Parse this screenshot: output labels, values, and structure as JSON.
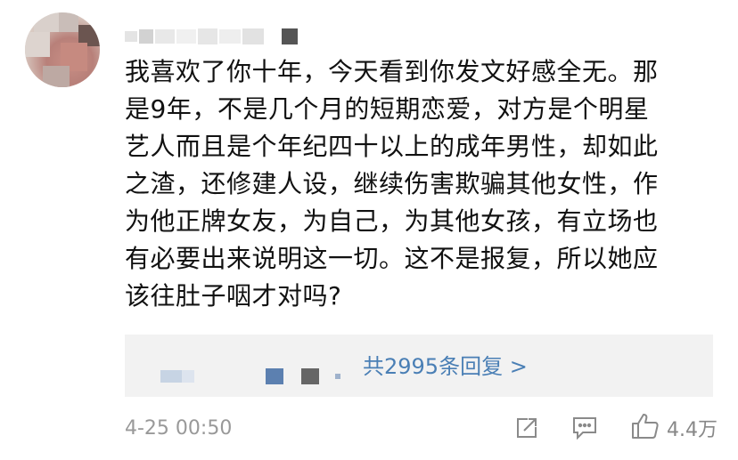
{
  "comment": {
    "text": "我喜欢了你十年，今天看到你发文好感全无。那\n是9年，不是几个月的短期恋爱，对方是个明星\n艺人而且是个年纪四十以上的成年男性，却如此\n之渣，还修建人设，继续伤害欺骗其他女性，作\n为他正牌女友，为自己，为其他女孩，有立场也\n有必要出来说明这一切。这不是报复，所以她应\n该往肚子咽才对吗?"
  },
  "replies": {
    "link_text": "共2995条回复 >"
  },
  "meta": {
    "timestamp": "4-25 00:50",
    "like_count": "4.4万"
  },
  "icons": [
    "share-icon",
    "comment-icon",
    "like-icon"
  ],
  "colors": {
    "link": "#4a7fb5",
    "meta_text": "#999999",
    "reply_bg": "#f2f2f2"
  }
}
